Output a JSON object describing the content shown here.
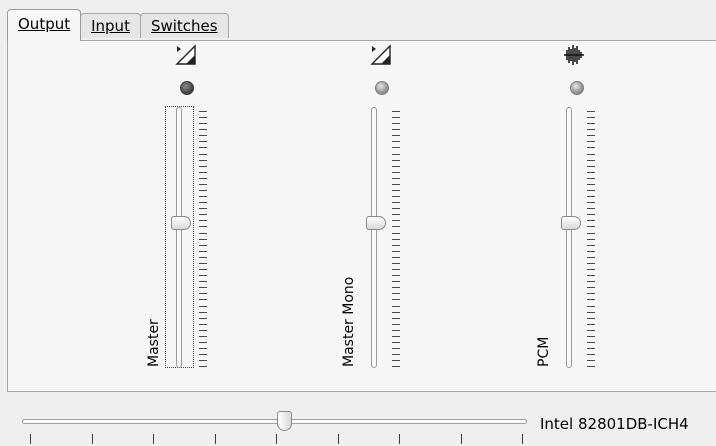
{
  "tabs": [
    {
      "label": "Output",
      "active": true
    },
    {
      "label": "Input",
      "active": false
    },
    {
      "label": "Switches",
      "active": false
    }
  ],
  "channels": [
    {
      "name": "Master",
      "icon": "volume-wedge-icon",
      "led": "mute-led-on",
      "volume_fraction": 0.56
    },
    {
      "name": "Master Mono",
      "icon": "volume-wedge-icon",
      "led": "mute-led-off",
      "volume_fraction": 0.56
    },
    {
      "name": "PCM",
      "icon": "waveform-icon",
      "led": "mute-led-off",
      "volume_fraction": 0.56
    }
  ],
  "device": {
    "name": "Intel 82801DB-ICH4",
    "master_slider_fraction": 0.52
  },
  "colors": {
    "window_bg": "#efefef",
    "panel_bg": "#f7f7f7",
    "border": "#a7a7a7"
  }
}
